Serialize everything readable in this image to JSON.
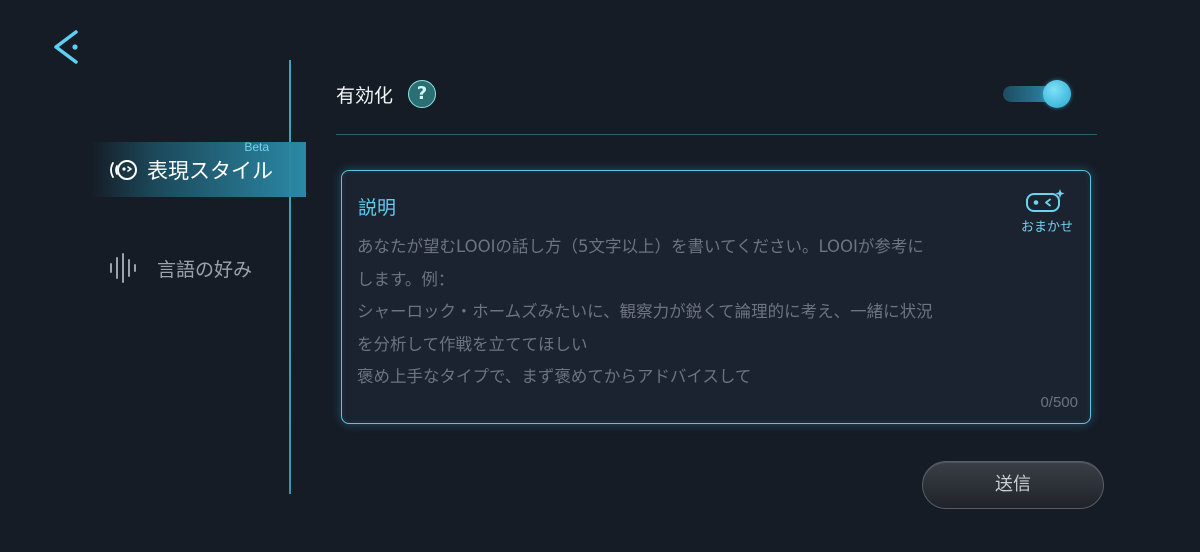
{
  "icons": {
    "back": "back-chevron-icon",
    "style": "face-sound-icon",
    "language": "sound-wave-icon",
    "help": "question-icon",
    "auto": "robot-sparkle-icon"
  },
  "colors": {
    "background": "#151c26",
    "accent": "#5ecfee",
    "active_item": "#2b89a6",
    "panel_border": "#5ec3de"
  },
  "sidebar": {
    "items": [
      {
        "label": "表現スタイル",
        "badge": "Beta",
        "active": true
      },
      {
        "label": "言語の好み",
        "active": false
      }
    ]
  },
  "enable": {
    "label": "有効化",
    "help_glyph": "?",
    "toggle_on": true
  },
  "description": {
    "title": "説明",
    "placeholder_lines": [
      "あなたが望むLOOIの話し方（5文字以上）を書いてください。LOOIが参考に",
      "します。例：",
      "シャーロック・ホームズみたいに、観察力が鋭くて論理的に考え、一緒に状況",
      "を分析して作戦を立ててほしい",
      "褒め上手なタイプで、まず褒めてからアドバイスして"
    ],
    "counter": "0/500",
    "auto_label": "おまかせ"
  },
  "send_label": "送信"
}
